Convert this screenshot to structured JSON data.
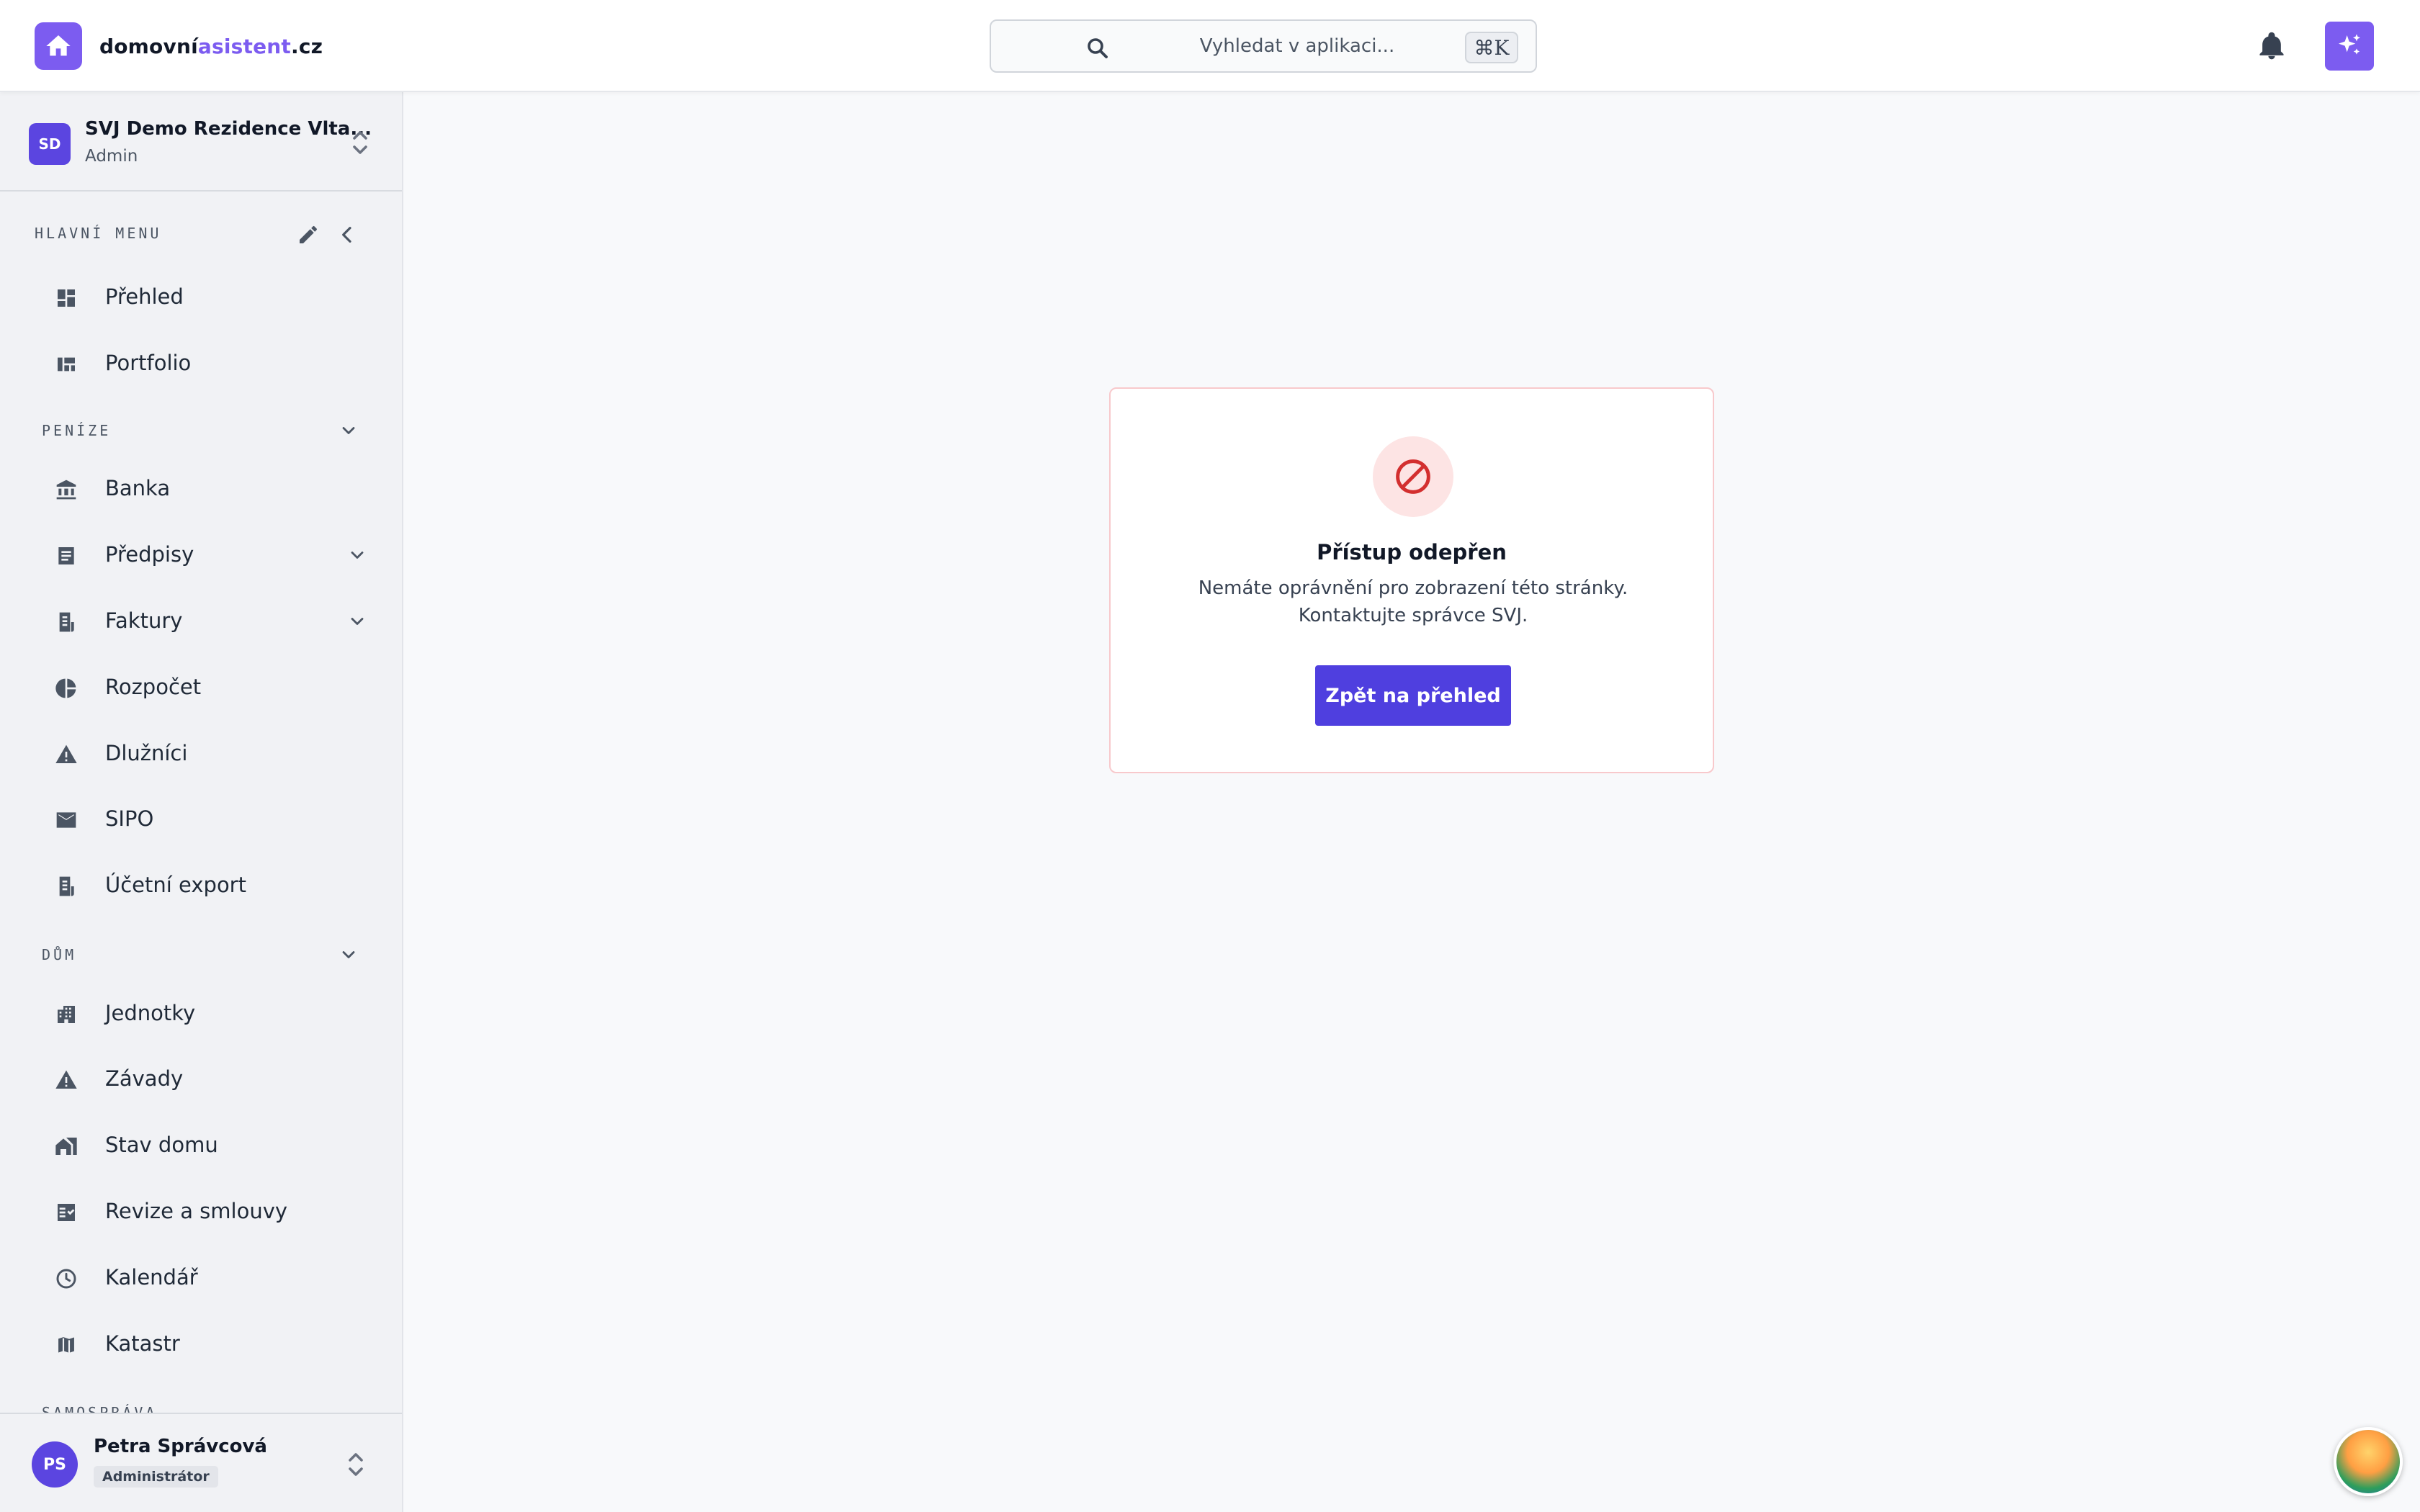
{
  "brand": {
    "name_part1": "domovní",
    "name_part2": "asistent",
    "name_part3": ".cz"
  },
  "search": {
    "placeholder": "Vyhledat v aplikaci...",
    "shortcut": "⌘K"
  },
  "org": {
    "initials": "SD",
    "name": "SVJ Demo Rezidence Vlta...",
    "role": "Admin"
  },
  "sidebar": {
    "main_header": "HLAVNÍ MENU",
    "main_items": [
      {
        "label": "Přehled",
        "icon": "dashboard-icon"
      },
      {
        "label": "Portfolio",
        "icon": "portfolio-icon"
      }
    ],
    "money_header": "PENÍZE",
    "money_items": [
      {
        "label": "Banka",
        "icon": "bank-icon"
      },
      {
        "label": "Předpisy",
        "icon": "list-icon"
      },
      {
        "label": "Faktury",
        "icon": "receipt-icon"
      },
      {
        "label": "Rozpočet",
        "icon": "pie-chart-icon"
      },
      {
        "label": "Dlužníci",
        "icon": "warning-icon"
      },
      {
        "label": "SIPO",
        "icon": "mail-icon"
      },
      {
        "label": "Účetní export",
        "icon": "receipt-icon"
      }
    ],
    "house_header": "DŮM",
    "house_items": [
      {
        "label": "Jednotky",
        "icon": "apartment-icon"
      },
      {
        "label": "Závady",
        "icon": "warning-icon"
      },
      {
        "label": "Stav domu",
        "icon": "house-status-icon"
      },
      {
        "label": "Revize a smlouvy",
        "icon": "checklist-icon"
      },
      {
        "label": "Kalendář",
        "icon": "clock-icon"
      },
      {
        "label": "Katastr",
        "icon": "map-icon"
      }
    ],
    "next_header": "SAMOSPRÁVA"
  },
  "user": {
    "initials": "PS",
    "name": "Petra Správcová",
    "role": "Administrátor"
  },
  "access_denied": {
    "title": "Přístup odepřen",
    "message": "Nemáte oprávnění pro zobrazení této stránky. Kontaktujte správce SVJ.",
    "button": "Zpět na přehled"
  },
  "colors": {
    "brand": "#7c5cf0",
    "primary_button": "#4f3fdf",
    "danger": "#d32f2f",
    "danger_bg": "#fde4e4"
  }
}
